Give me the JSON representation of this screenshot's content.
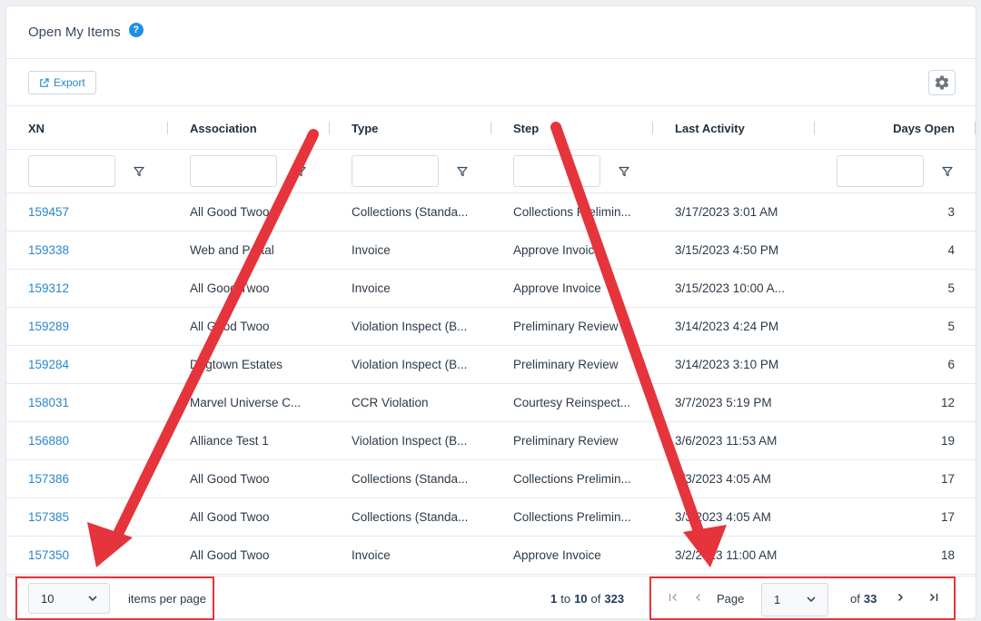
{
  "panel": {
    "title": "Open My Items",
    "help_icon": "?"
  },
  "toolbar": {
    "export_label": "Export",
    "export_icon": "external-link-icon",
    "settings_icon": "gear-icon"
  },
  "columns": [
    {
      "key": "xn",
      "label": "XN",
      "filterable": true
    },
    {
      "key": "association",
      "label": "Association",
      "filterable": true
    },
    {
      "key": "type",
      "label": "Type",
      "filterable": true
    },
    {
      "key": "step",
      "label": "Step",
      "filterable": true
    },
    {
      "key": "last_activity",
      "label": "Last Activity",
      "filterable": false
    },
    {
      "key": "days_open",
      "label": "Days Open",
      "filterable": true
    }
  ],
  "rows": [
    {
      "xn": "159457",
      "association": "All Good Twoo",
      "type": "Collections (Standa...",
      "step": "Collections Prelimin...",
      "last_activity": "3/17/2023 3:01 AM",
      "days_open": "3"
    },
    {
      "xn": "159338",
      "association": "Web and Portal",
      "type": "Invoice",
      "step": "Approve Invoice",
      "last_activity": "3/15/2023 4:50 PM",
      "days_open": "4"
    },
    {
      "xn": "159312",
      "association": "All Good Twoo",
      "type": "Invoice",
      "step": "Approve Invoice",
      "last_activity": "3/15/2023 10:00 A...",
      "days_open": "5"
    },
    {
      "xn": "159289",
      "association": "All Good Twoo",
      "type": "Violation Inspect (B...",
      "step": "Preliminary Review",
      "last_activity": "3/14/2023 4:24 PM",
      "days_open": "5"
    },
    {
      "xn": "159284",
      "association": "Dogtown Estates",
      "type": "Violation Inspect (B...",
      "step": "Preliminary Review",
      "last_activity": "3/14/2023 3:10 PM",
      "days_open": "6"
    },
    {
      "xn": "158031",
      "association": "Marvel Universe C...",
      "type": "CCR Violation",
      "step": "Courtesy Reinspect...",
      "last_activity": "3/7/2023 5:19 PM",
      "days_open": "12"
    },
    {
      "xn": "156880",
      "association": "Alliance Test 1",
      "type": "Violation Inspect (B...",
      "step": "Preliminary Review",
      "last_activity": "3/6/2023 11:53 AM",
      "days_open": "19"
    },
    {
      "xn": "157386",
      "association": "All Good Twoo",
      "type": "Collections (Standa...",
      "step": "Collections Prelimin...",
      "last_activity": "3/3/2023 4:05 AM",
      "days_open": "17"
    },
    {
      "xn": "157385",
      "association": "All Good Twoo",
      "type": "Collections (Standa...",
      "step": "Collections Prelimin...",
      "last_activity": "3/3/2023 4:05 AM",
      "days_open": "17"
    },
    {
      "xn": "157350",
      "association": "All Good Twoo",
      "type": "Invoice",
      "step": "Approve Invoice",
      "last_activity": "3/2/2023 11:00 AM",
      "days_open": "18"
    }
  ],
  "pager": {
    "page_size": "10",
    "per_page_label": "items per page",
    "range_from": "1",
    "range_to_word": "to",
    "range_to": "10",
    "range_of_word": "of",
    "range_total": "323",
    "page_label": "Page",
    "current_page": "1",
    "of_word": "of",
    "total_pages": "33"
  },
  "colors": {
    "accent": "#2a87c8",
    "help": "#1f8fe5",
    "annotation": "#e5343b"
  }
}
